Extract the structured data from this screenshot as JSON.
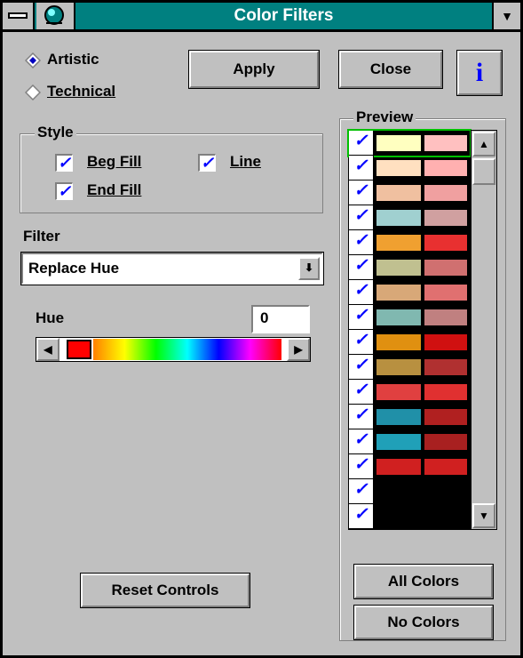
{
  "window": {
    "title": "Color Filters"
  },
  "mode": {
    "options": [
      {
        "label": "Artistic",
        "selected": true
      },
      {
        "label": "Technical",
        "selected": false
      }
    ]
  },
  "toolbar": {
    "apply_label": "Apply",
    "close_label": "Close",
    "info_icon": "i"
  },
  "style": {
    "legend": "Style",
    "beg_fill": {
      "label": "Beg Fill",
      "checked": true
    },
    "line": {
      "label": "Line",
      "checked": true
    },
    "end_fill": {
      "label": "End Fill",
      "checked": true
    }
  },
  "filter": {
    "label": "Filter",
    "value": "Replace Hue"
  },
  "hue": {
    "label": "Hue",
    "value": "0"
  },
  "preview": {
    "legend": "Preview",
    "rows": [
      {
        "left": "#ffffc0",
        "right": "#ffc0c0",
        "checked": true,
        "selected": true
      },
      {
        "left": "#ffe0c0",
        "right": "#ffb0b0",
        "checked": true
      },
      {
        "left": "#f0c0a0",
        "right": "#f0a0a0",
        "checked": true
      },
      {
        "left": "#a0d0d0",
        "right": "#d0a0a0",
        "checked": true
      },
      {
        "left": "#f0a030",
        "right": "#e83030",
        "checked": true
      },
      {
        "left": "#c0c090",
        "right": "#d07070",
        "checked": true
      },
      {
        "left": "#d8a878",
        "right": "#e07070",
        "checked": true
      },
      {
        "left": "#80b8b0",
        "right": "#c08080",
        "checked": true
      },
      {
        "left": "#e09010",
        "right": "#d01010",
        "checked": true
      },
      {
        "left": "#b89040",
        "right": "#b03030",
        "checked": true
      },
      {
        "left": "#e04040",
        "right": "#e03030",
        "checked": true
      },
      {
        "left": "#2090a8",
        "right": "#b02020",
        "checked": true
      },
      {
        "left": "#20a0b8",
        "right": "#a82020",
        "checked": true
      },
      {
        "left": "#d02020",
        "right": "#d02020",
        "checked": true
      },
      {
        "left": "#000000",
        "right": "#000000",
        "checked": true
      },
      {
        "left": "#000000",
        "right": "#000000",
        "checked": true
      }
    ]
  },
  "buttons": {
    "reset_label": "Reset Controls",
    "all_colors_label": "All Colors",
    "no_colors_label": "No Colors"
  },
  "colors": {
    "titlebar": "#008080",
    "face": "#c0c0c0",
    "check": "#0000ff"
  },
  "icons": [
    "system-menu-icon",
    "globe-icon",
    "dropdown-arrow-icon",
    "info-icon",
    "scroll-left-icon",
    "scroll-right-icon",
    "scroll-up-icon",
    "scroll-down-icon"
  ]
}
